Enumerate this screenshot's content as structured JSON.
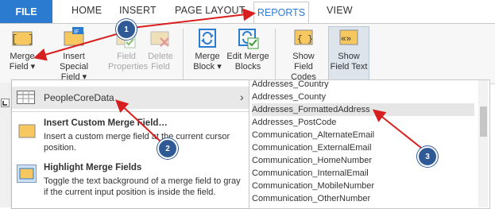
{
  "tabs": [
    "FILE",
    "HOME",
    "INSERT",
    "PAGE LAYOUT",
    "REPORTS",
    "VIEW"
  ],
  "ribbon": {
    "merge_field": [
      "Merge",
      "Field ▾"
    ],
    "insert_special": [
      "Insert Special",
      "Field ▾"
    ],
    "field_properties": [
      "Field",
      "Properties"
    ],
    "delete_field": [
      "Delete",
      "Field"
    ],
    "merge_block": [
      "Merge",
      "Block ▾"
    ],
    "edit_merge_blocks": [
      "Edit Merge",
      "Blocks"
    ],
    "show_field_codes": [
      "Show Field",
      "Codes"
    ],
    "show_field_text": [
      "Show",
      "Field Text"
    ],
    "if_badge": "IF"
  },
  "menu": {
    "datasource": "PeopleCoreData",
    "submenu_arrow": "›",
    "insert_custom_title": "Insert Custom Merge Field…",
    "insert_custom_desc": [
      "Insert a custom merge field at the current cursor",
      "position."
    ],
    "highlight_title": "Highlight Merge Fields",
    "highlight_desc": [
      "Toggle the text background of a merge field to gray",
      "if the current input position is inside the field."
    ]
  },
  "fields": [
    "Addresses_Country",
    "Addresses_County",
    "Addresses_FormattedAddress",
    "Addresses_PostCode",
    "Communication_AlternateEmail",
    "Communication_ExternalEmail",
    "Communication_HomeNumber",
    "Communication_InternalEmail",
    "Communication_MobileNumber",
    "Communication_OtherNumber"
  ],
  "callouts": [
    "1",
    "2",
    "3"
  ],
  "colors": {
    "accent": "#2b7bd1",
    "callout": "#2f5a96",
    "arrow": "#d81f1f",
    "field_icon": "#f6c85f"
  }
}
